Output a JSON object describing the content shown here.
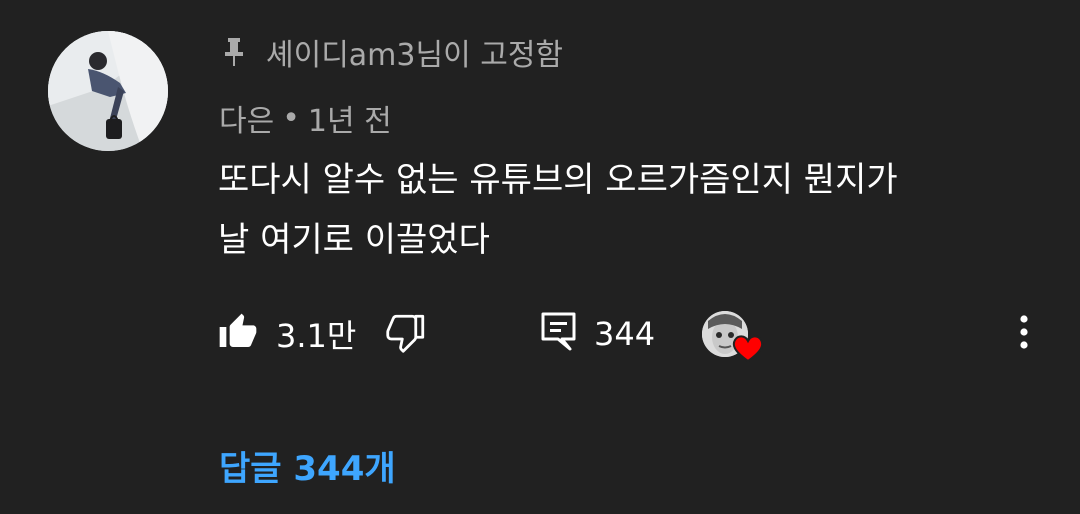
{
  "comment": {
    "pinned_label": "셰이디am3님이 고정함",
    "author": "다은",
    "separator": "•",
    "time": "1년 전",
    "text": "또다시 알수 없는 유튜브의 오르가즘인지 뭔지가\n날 여기로 이끌었다",
    "like_count": "3.1만",
    "reply_count": "344",
    "replies_link": "답글 344개"
  },
  "icons": {
    "pin": "pin-icon",
    "like": "thumb-up-icon",
    "dislike": "thumb-down-icon",
    "reply": "comment-icon",
    "heart": "heart-icon",
    "more": "more-vertical-icon"
  },
  "colors": {
    "background": "#212121",
    "text": "#ffffff",
    "secondary_text": "#aaaaaa",
    "link": "#3ea6ff",
    "heart": "#ff0000"
  }
}
